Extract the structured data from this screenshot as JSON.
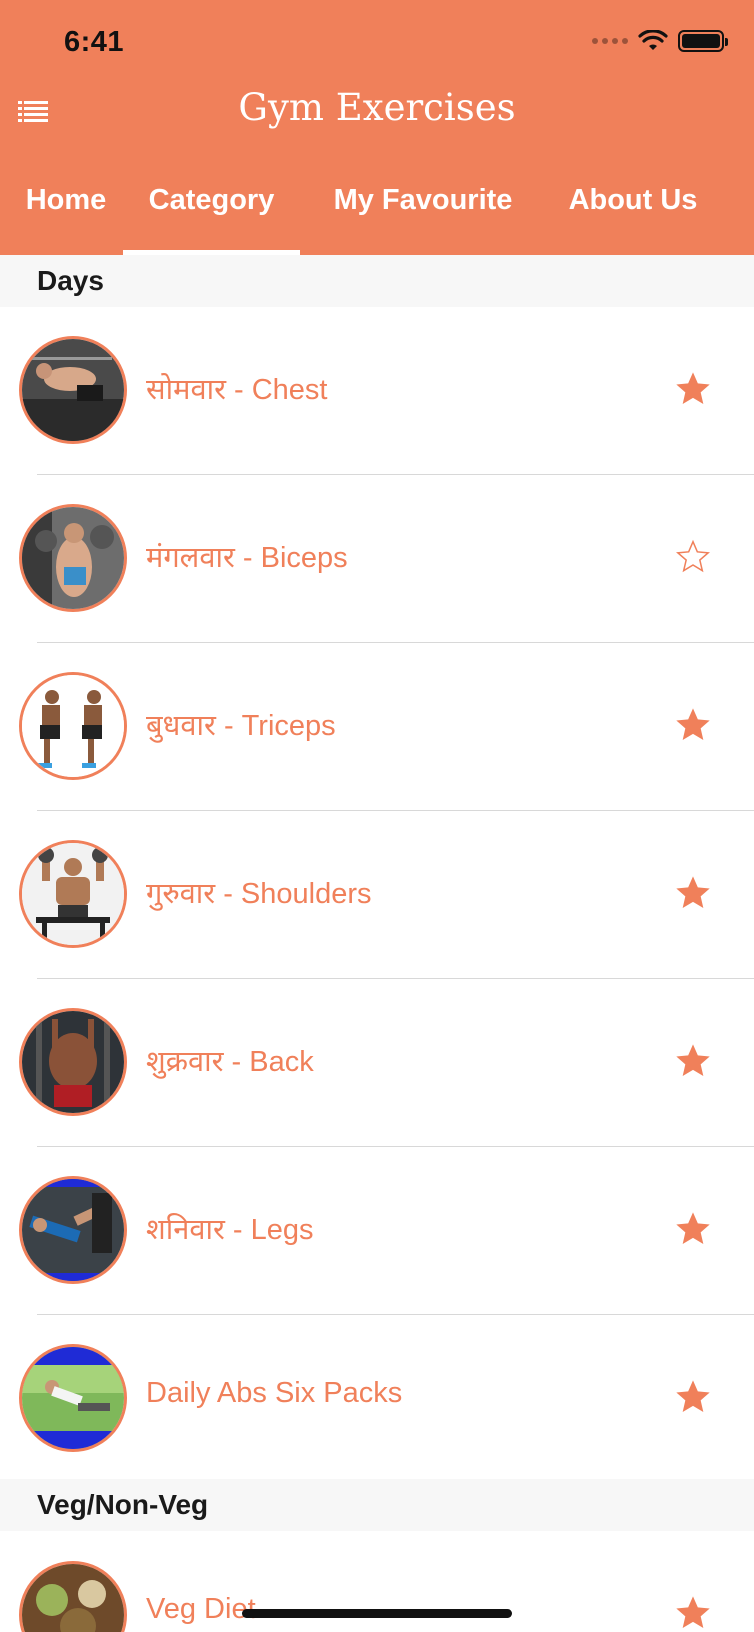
{
  "status_bar": {
    "time": "6:41"
  },
  "header": {
    "title": "Gym Exercises",
    "menu_icon": "list-menu-icon",
    "background": "#F0805A"
  },
  "tabs": [
    {
      "label": "Home",
      "selected": false
    },
    {
      "label": "Category",
      "selected": true
    },
    {
      "label": "My Favourite",
      "selected": false
    },
    {
      "label": "About Us",
      "selected": false
    }
  ],
  "sections": [
    {
      "title": "Days",
      "items": [
        {
          "label": "सोमवार - Chest",
          "favourite": true
        },
        {
          "label": "मंगलवार - Biceps",
          "favourite": false
        },
        {
          "label": "बुधवार - Triceps",
          "favourite": true
        },
        {
          "label": "गुरुवार - Shoulders",
          "favourite": true
        },
        {
          "label": "शुक्रवार - Back",
          "favourite": true
        },
        {
          "label": "शनिवार - Legs",
          "favourite": true
        },
        {
          "label": "Daily Abs Six Packs",
          "favourite": true
        }
      ]
    },
    {
      "title": "Veg/Non-Veg",
      "items": [
        {
          "label": "Veg Diet",
          "favourite": true
        }
      ]
    }
  ],
  "colors": {
    "accent": "#F0805A",
    "section_bg": "#F7F7F7",
    "divider": "#D8D8D8"
  }
}
